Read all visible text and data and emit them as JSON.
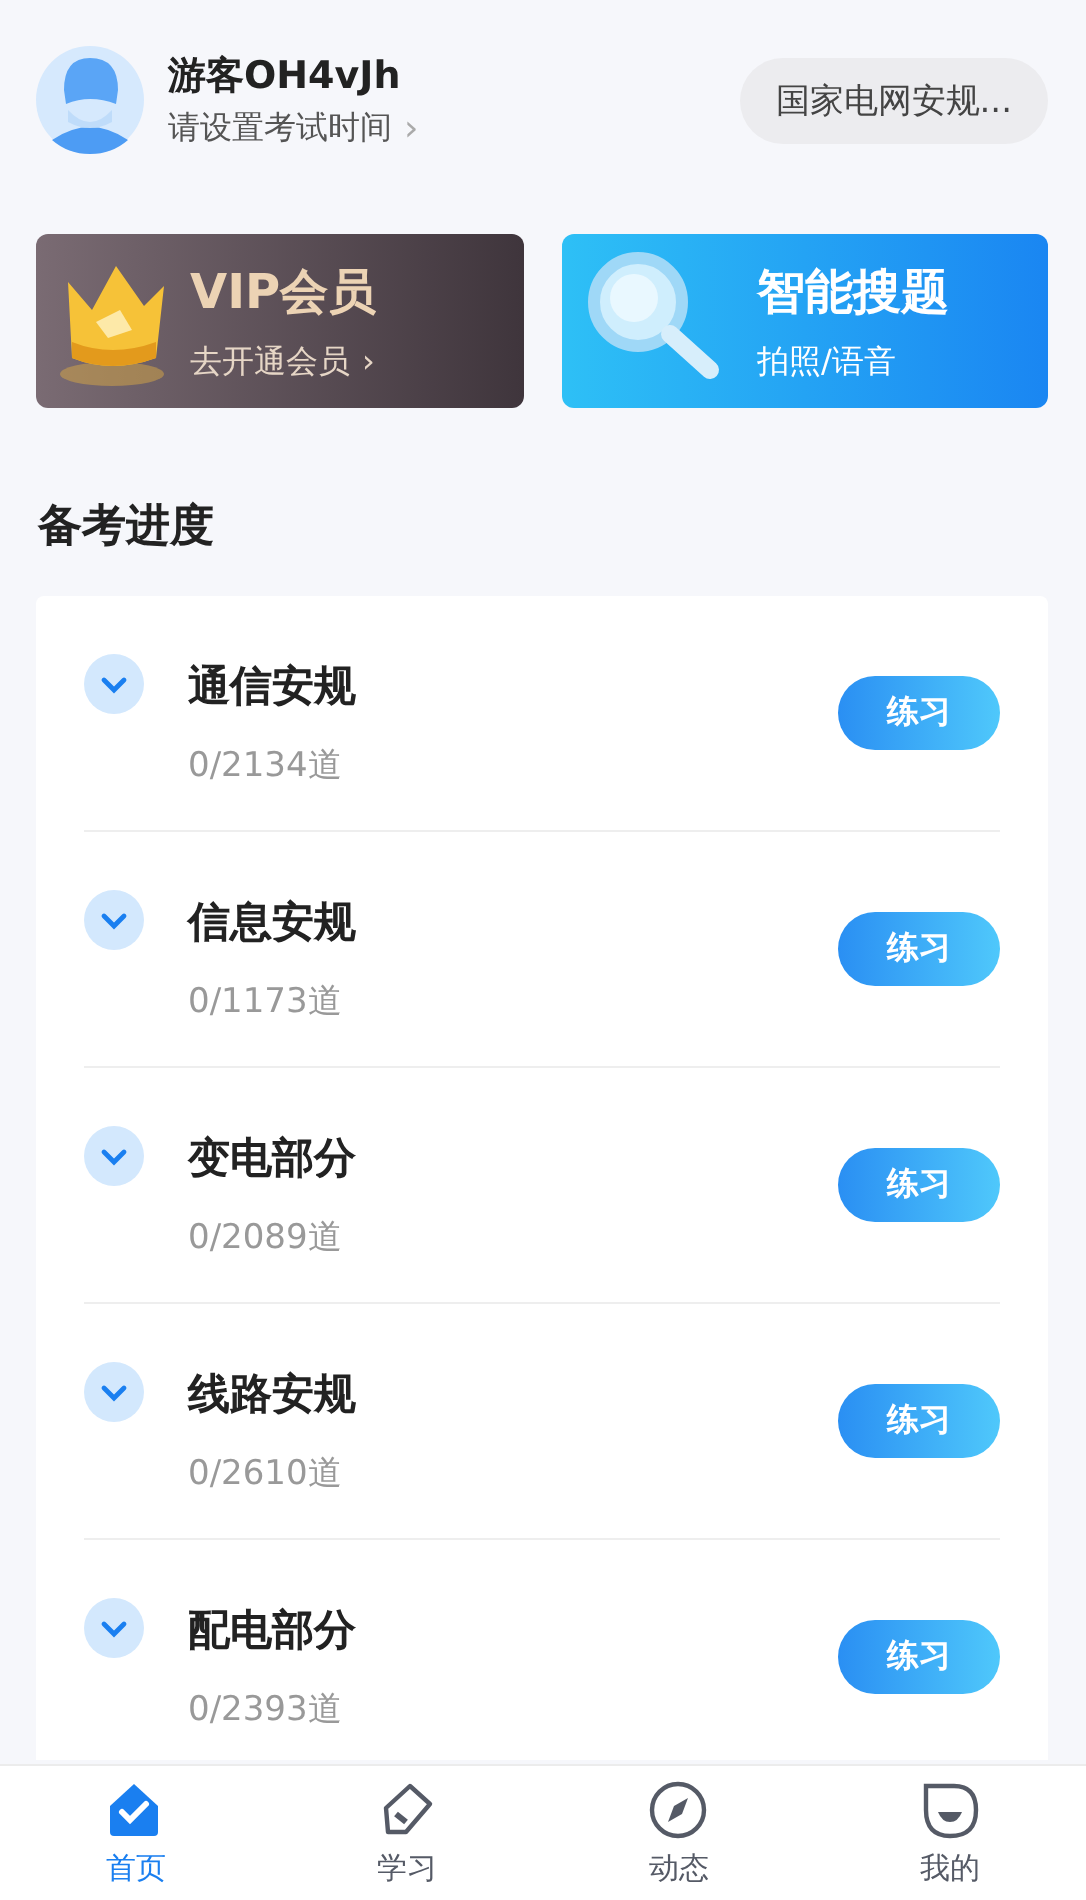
{
  "user": {
    "name": "游客OH4vJh",
    "subtitle": "请设置考试时间",
    "chevron": "›"
  },
  "exam_selector": {
    "label": "国家电网安规..."
  },
  "promos": [
    {
      "kind": "vip",
      "title": "VIP会员",
      "subtitle": "去开通会员",
      "chevron": "›"
    },
    {
      "kind": "search",
      "title": "智能搜题",
      "subtitle": "拍照/语音"
    }
  ],
  "section_title": "备考进度",
  "subjects": [
    {
      "name": "通信安规",
      "progress": "0/2134道",
      "button": "练习",
      "expanded": false
    },
    {
      "name": "信息安规",
      "progress": "0/1173道",
      "button": "练习",
      "expanded": false
    },
    {
      "name": "变电部分",
      "progress": "0/2089道",
      "button": "练习",
      "expanded": false
    },
    {
      "name": "线路安规",
      "progress": "0/2610道",
      "button": "练习",
      "expanded": false
    },
    {
      "name": "配电部分",
      "progress": "0/2393道",
      "button": "练习",
      "expanded": false
    }
  ],
  "tab_bar": [
    {
      "kind": "home",
      "label": "首页",
      "selected": true
    },
    {
      "kind": "study",
      "label": "学习",
      "selected": false
    },
    {
      "kind": "explore",
      "label": "动态",
      "selected": false
    },
    {
      "kind": "profile",
      "label": "我的",
      "selected": false
    }
  ]
}
